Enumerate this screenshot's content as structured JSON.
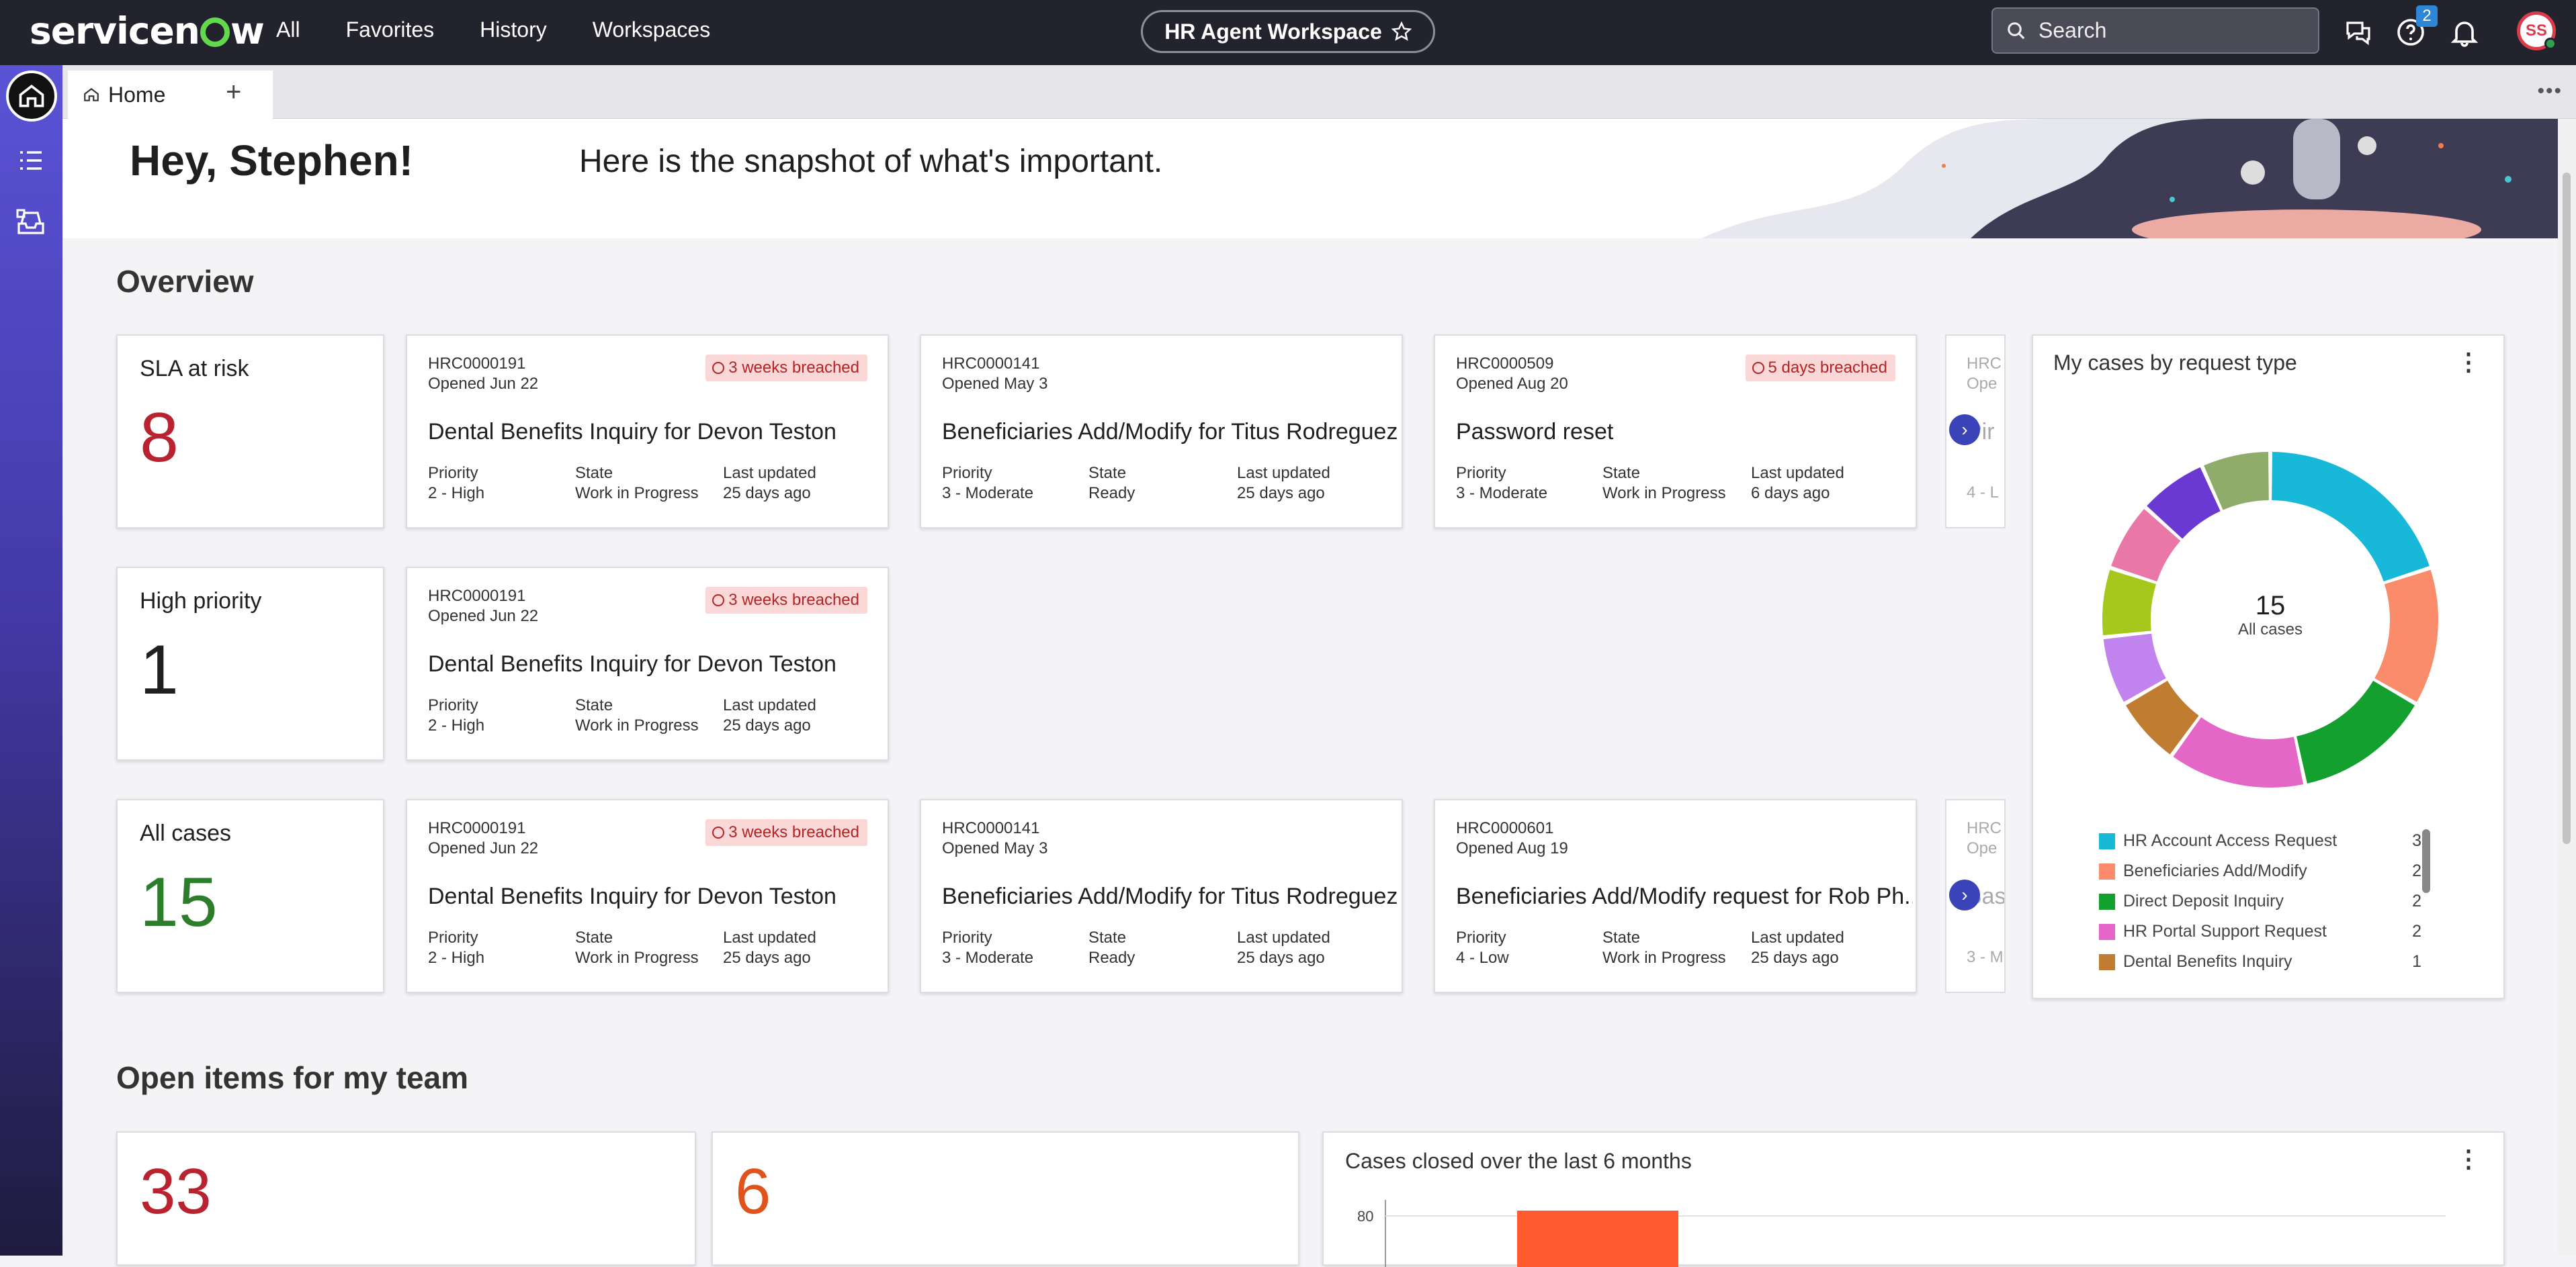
{
  "topbar": {
    "brand": "servicenow",
    "nav": [
      "All",
      "Favorites",
      "History",
      "Workspaces"
    ],
    "workspace": "HR Agent Workspace",
    "search_placeholder": "Search",
    "help_badge": "2",
    "avatar_initials": "SS"
  },
  "tabs": {
    "home": "Home"
  },
  "hero": {
    "greeting": "Hey, Stephen!",
    "subtitle": "Here is the snapshot of what's important."
  },
  "overview": {
    "title": "Overview",
    "kpis": [
      {
        "label": "SLA at risk",
        "value": "8",
        "color": "#b8232f"
      },
      {
        "label": "High priority",
        "value": "1",
        "color": "#1f1f1f"
      },
      {
        "label": "All cases",
        "value": "15",
        "color": "#2d7d2d"
      }
    ],
    "field_labels": {
      "priority": "Priority",
      "state": "State",
      "updated": "Last updated"
    },
    "rows": [
      [
        {
          "id": "HRC0000191",
          "opened": "Opened Jun 22",
          "title": "Dental Benefits Inquiry for Devon Teston",
          "priority": "2 - High",
          "state": "Work in Progress",
          "updated": "25 days ago",
          "badge": "3 weeks breached"
        },
        {
          "id": "HRC0000141",
          "opened": "Opened May 3",
          "title": "Beneficiaries Add/Modify for Titus Rodreguez",
          "priority": "3 - Moderate",
          "state": "Ready",
          "updated": "25 days ago",
          "badge": ""
        },
        {
          "id": "HRC0000509",
          "opened": "Opened Aug 20",
          "title": "Password reset",
          "priority": "3 - Moderate",
          "state": "Work in Progress",
          "updated": "6 days ago",
          "badge": "5 days breached"
        }
      ],
      [
        {
          "id": "HRC0000191",
          "opened": "Opened Jun 22",
          "title": "Dental Benefits Inquiry for Devon Teston",
          "priority": "2 - High",
          "state": "Work in Progress",
          "updated": "25 days ago",
          "badge": "3 weeks breached"
        }
      ],
      [
        {
          "id": "HRC0000191",
          "opened": "Opened Jun 22",
          "title": "Dental Benefits Inquiry for Devon Teston",
          "priority": "2 - High",
          "state": "Work in Progress",
          "updated": "25 days ago",
          "badge": "3 weeks breached"
        },
        {
          "id": "HRC0000141",
          "opened": "Opened May 3",
          "title": "Beneficiaries Add/Modify for Titus Rodreguez",
          "priority": "3 - Moderate",
          "state": "Ready",
          "updated": "25 days ago",
          "badge": ""
        },
        {
          "id": "HRC0000601",
          "opened": "Opened Aug 19",
          "title": "Beneficiaries Add/Modify request for Rob Ph...",
          "priority": "4 - Low",
          "state": "Work in Progress",
          "updated": "25 days ago",
          "badge": ""
        }
      ]
    ],
    "peek": [
      {
        "id": "HRC",
        "opened": "Ope",
        "title": "Pir",
        "prio": "4 - L"
      },
      {
        "id": "HRC",
        "opened": "Ope",
        "title": "Bas",
        "prio": "3 - M"
      }
    ]
  },
  "donut": {
    "title": "My cases by request type",
    "center_value": "15",
    "center_label": "All cases"
  },
  "chart_data": [
    {
      "type": "pie",
      "title": "My cases by request type",
      "total": 15,
      "slices": [
        {
          "label": "HR Account Access Request",
          "value": 3,
          "color": "#17b8d8"
        },
        {
          "label": "Beneficiaries Add/Modify",
          "value": 2,
          "color": "#fa8c6c"
        },
        {
          "label": "Direct Deposit Inquiry",
          "value": 2,
          "color": "#14a02e"
        },
        {
          "label": "HR Portal Support Request",
          "value": 2,
          "color": "#e466c6"
        },
        {
          "label": "Dental Benefits Inquiry",
          "value": 1,
          "color": "#c07d32"
        },
        {
          "label": "",
          "value": 1,
          "color": "#c184ee"
        },
        {
          "label": "",
          "value": 1,
          "color": "#a6c81c"
        },
        {
          "label": "",
          "value": 1,
          "color": "#e978a8"
        },
        {
          "label": "",
          "value": 1,
          "color": "#6a38d2"
        },
        {
          "label": "",
          "value": 1,
          "color": "#8fac6a"
        }
      ]
    },
    {
      "type": "bar",
      "title": "Cases closed over the last 6 months",
      "ytick": "80",
      "values": [
        82
      ],
      "color": "#ff5a30"
    }
  ],
  "team": {
    "title": "Open items for my team",
    "kpi1": "33",
    "kpi1_color": "#b8232f",
    "kpi2": "6",
    "kpi2_color": "#e0531b"
  },
  "barchart": {
    "title": "Cases closed over the last 6 months",
    "ytick": "80"
  }
}
